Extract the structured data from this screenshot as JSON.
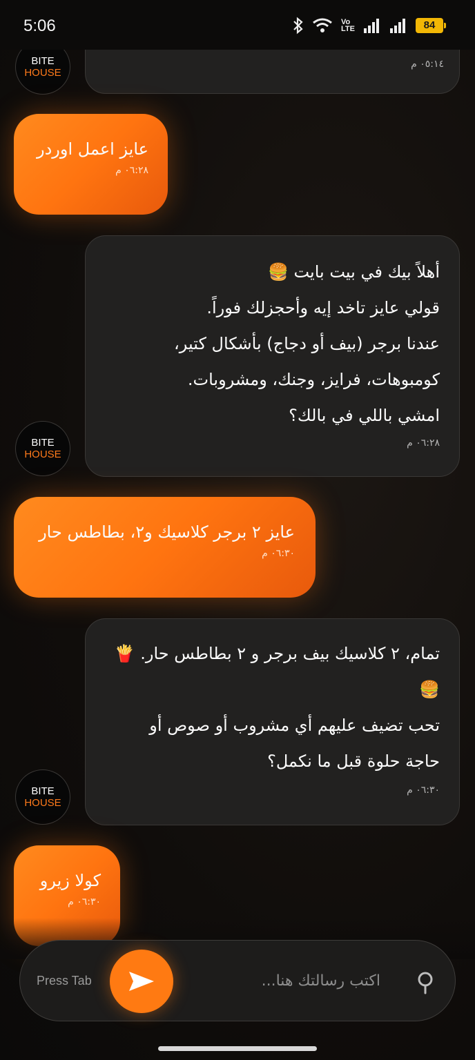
{
  "status_bar": {
    "time": "5:06",
    "network_label_top": "Vo",
    "network_label_bottom": "LTE",
    "battery": "84",
    "icons": [
      "bluetooth-icon",
      "wifi-icon",
      "signal-icon",
      "signal-icon"
    ]
  },
  "avatar": {
    "line1": "BITE",
    "line2": "HOUSE"
  },
  "messages": [
    {
      "from": "bot",
      "text": "",
      "time": "٠٥:١٤ م"
    },
    {
      "from": "user",
      "text": "عايز اعمل اوردر",
      "time": "٠٦:٢٨ م"
    },
    {
      "from": "bot",
      "lines": [
        "أهلاً بيك في بيت بايت 🍔",
        "قولي عايز تاخد إيه وأحجزلك فوراً.",
        "عندنا برجر (بيف أو دجاج) بأشكال كتير،",
        "كومبوهات، فرايز، وجنك، ومشروبات.",
        "امشي باللي في بالك؟"
      ],
      "time": "٠٦:٢٨ م"
    },
    {
      "from": "user",
      "text": "عايز ٢ برجر كلاسيك و٢، بطاطس حار",
      "time": "٠٦:٣٠ م"
    },
    {
      "from": "bot",
      "lines": [
        "تمام، ٢ كلاسيك بيف برجر و ٢ بطاطس حار. 🍟",
        "🍔",
        "تحب تضيف عليهم أي مشروب أو صوص أو",
        "حاجة حلوة قبل ما نكمل؟"
      ],
      "time": "٠٦:٣٠ م"
    },
    {
      "from": "user",
      "text": "كولا زيرو",
      "time": "٠٦:٣٠ م"
    }
  ],
  "composer": {
    "hint": "Press Tab",
    "placeholder": "اكتب رسالتك هنا...",
    "send_icon": "send-icon",
    "location_icon": "location-pin-icon"
  },
  "colors": {
    "accent": "#ff7a12",
    "bubble_bot": "#222120",
    "background": "#0f0d0c"
  }
}
